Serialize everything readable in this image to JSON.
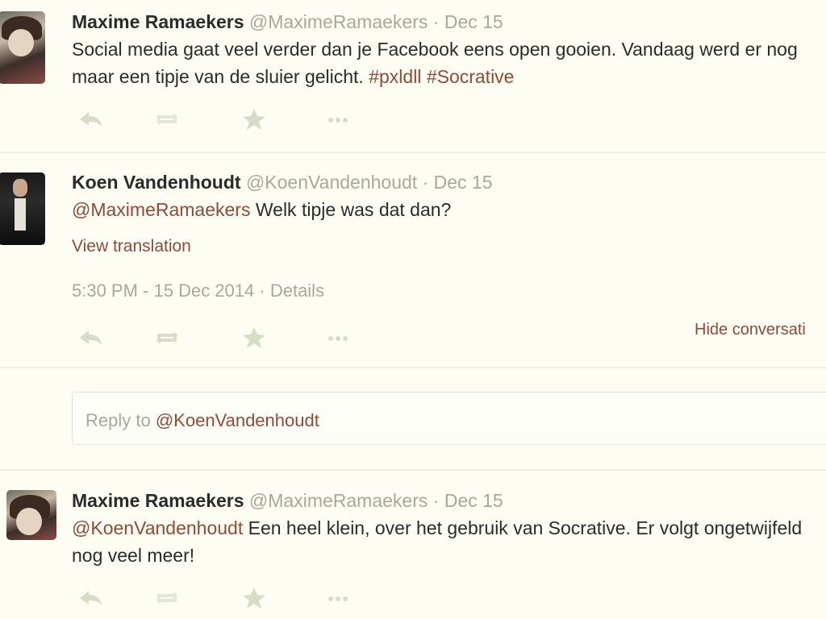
{
  "tweets": [
    {
      "name": "Maxime Ramaekers",
      "handle": "@MaximeRamaekers",
      "separator": "·",
      "date": "Dec 15",
      "text_plain": "Social media gaat veel verder dan je Facebook eens open gooien. Vandaag werd er nog maar een tipje van de sluier gelicht.",
      "hashtags": [
        "#pxldll",
        "#Socrative"
      ]
    },
    {
      "name": "Koen Vandenhoudt",
      "handle": "@KoenVandenhoudt",
      "separator": "·",
      "date": "Dec 15",
      "mention": "@MaximeRamaekers",
      "text_plain": "Welk tipje was dat dan?",
      "view_translation": "View translation",
      "timestamp": "5:30 PM - 15 Dec 2014",
      "details": "Details",
      "hide_conversation": "Hide conversati"
    },
    {
      "name": "Maxime Ramaekers",
      "handle": "@MaximeRamaekers",
      "separator": "·",
      "date": "Dec 15",
      "mention": "@KoenVandenhoudt",
      "text_plain": "Een heel klein, over het gebruik van Socrative. Er volgt ongetwijfeld nog veel meer!"
    }
  ],
  "reply": {
    "prefix": "Reply to",
    "mention": "@KoenVandenhoudt"
  },
  "icons": {
    "reply": "reply-icon",
    "retweet": "retweet-icon",
    "favorite": "star-icon",
    "more": "more-icon"
  },
  "colors": {
    "background": "#fdfdf4",
    "link": "#8d4b3a",
    "muted": "#a8a89a",
    "action": "#d6dcc6"
  }
}
